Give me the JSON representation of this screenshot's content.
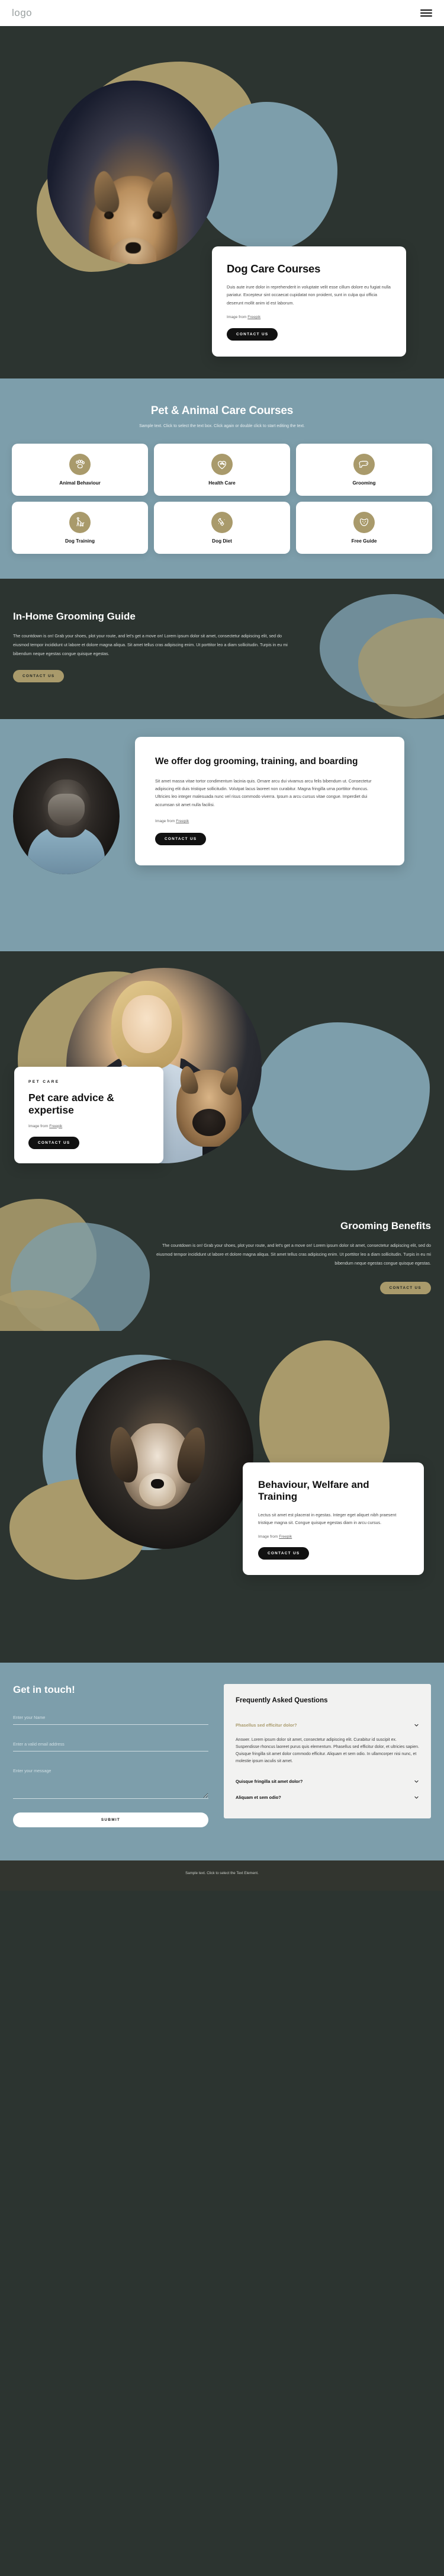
{
  "header": {
    "logo": "logo",
    "menu_icon": "hamburger-menu-icon"
  },
  "hero": {
    "title": "Dog Care Courses",
    "body": "Duis aute irure dolor in reprehenderit in voluptate velit esse cillum dolore eu fugiat nulla pariatur. Excepteur sint occaecat cupidatat non proident, sunt in culpa qui officia deserunt mollit anim id est laborum.",
    "credit_prefix": "Image from ",
    "credit_link": "Freepik",
    "cta": "CONTACT US"
  },
  "courses": {
    "title": "Pet & Animal Care Courses",
    "subtitle": "Sample text. Click to select the text box. Click again or double click to start editing the text.",
    "items": [
      {
        "label": "Animal Behaviour",
        "icon": "paw-icon"
      },
      {
        "label": "Health Care",
        "icon": "heart-paw-icon"
      },
      {
        "label": "Grooming",
        "icon": "dog-head-icon"
      },
      {
        "label": "Dog Training",
        "icon": "person-walking-dog-icon"
      },
      {
        "label": "Dog Diet",
        "icon": "bone-heart-icon"
      },
      {
        "label": "Free Guide",
        "icon": "dog-face-icon"
      }
    ]
  },
  "guide": {
    "title": "In-Home Grooming Guide",
    "body": "The countdown is on! Grab your shoes, plot your route, and let's get a move on! Lorem ipsum dolor sit amet, consectetur adipiscing elit, sed do eiusmod tempor incididunt ut labore et dolore magna aliqua. Sit amet tellus cras adipiscing enim. Ut porttitor leo a diam sollicitudin. Turpis in eu mi bibendum neque egestas congue quisque egestas.",
    "cta": "CONTACT US"
  },
  "offer": {
    "title": "We offer dog grooming, training, and boarding",
    "body": "Sit amet massa vitae tortor condimentum lacinia quis. Ornare arcu dui vivamus arcu felis bibendum ut. Consectetur adipiscing elit duis tristique sollicitudin. Volutpat lacus laoreet non curabitur. Magna fringilla urna porttitor rhoncus. Ultricies leo integer malesuada nunc vel risus commodo viverra. Ipsum a arcu cursus vitae congue. Imperdiet dui accumsan sit amet nulla facilisi.",
    "credit_prefix": "Image from ",
    "credit_link": "Freepik",
    "cta": "CONTACT US"
  },
  "expert": {
    "eyebrow": "PET CARE",
    "title": "Pet care advice & expertise",
    "credit_prefix": "Image from ",
    "credit_link": "Freepik",
    "cta": "CONTACT US"
  },
  "benefits": {
    "title": "Grooming Benefits",
    "body": "The countdown is on! Grab your shoes, plot your route, and let's get a move on! Lorem ipsum dolor sit amet, consectetur adipiscing elit, sed do eiusmod tempor incididunt ut labore et dolore magna aliqua. Sit amet tellus cras adipiscing enim. Ut porttitor leo a diam sollicitudin. Turpis in eu mi bibendum neque egestas congue quisque egestas.",
    "cta": "CONTACT US"
  },
  "behaviour": {
    "title": "Behaviour, Welfare and Training",
    "body": "Lectus sit amet est placerat in egestas. Integer eget aliquet nibh praesent tristique magna sit. Congue quisque egestas diam in arcu cursus.",
    "credit_prefix": "Image from ",
    "credit_link": "Freepik",
    "cta": "CONTACT US"
  },
  "contact": {
    "title": "Get in touch!",
    "name_placeholder": "Enter your Name",
    "email_placeholder": "Enter a valid email address",
    "message_placeholder": "Enter your message",
    "name_value": "",
    "email_value": "",
    "message_value": "",
    "submit": "SUBMIT"
  },
  "faq": {
    "title": "Frequently Asked Questions",
    "items": [
      {
        "question": "Phasellus sed efficitur dolor?",
        "answer": "Answer. Lorem ipsum dolor sit amet, consectetur adipiscing elit. Curabitur id suscipit ex. Suspendisse rhoncus laoreet purus quis elementum. Phasellus sed efficitur dolor, et ultricies sapien. Quisque fringilla sit amet dolor commodo efficitur. Aliquam et sem odio. In ullamcorper nisi nunc, et molestie ipsum iaculis sit amet.",
        "open": true
      },
      {
        "question": "Quisque fringilla sit amet dolor?",
        "answer": "",
        "open": false
      },
      {
        "question": "Aliquam et sem odio?",
        "answer": "",
        "open": false
      }
    ]
  },
  "footer": {
    "text": "Sample text. Click to select the Text Element."
  },
  "colors": {
    "dark": "#2c3430",
    "steel_blue": "#7d9eab",
    "olive": "#a99a6b",
    "card_white": "#ffffff",
    "faq_bg": "#f2f2f1",
    "footer_bg": "#32352f"
  }
}
